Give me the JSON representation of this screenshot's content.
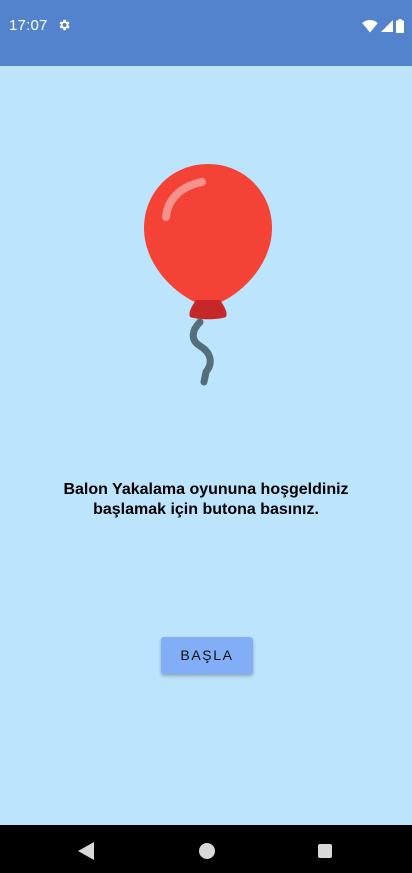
{
  "status_bar": {
    "time": "17:07",
    "icons": [
      "gear-icon",
      "wifi-icon",
      "signal-icon",
      "battery-icon"
    ]
  },
  "main": {
    "balloon_icon": "balloon-icon",
    "welcome_text": "Balon Yakalama oyununa hoşgeldiniz başlamak için butona basınız.",
    "start_button_label": "BAŞLA"
  },
  "nav_bar": {
    "icons": [
      "back-icon",
      "home-icon",
      "recents-icon"
    ]
  },
  "colors": {
    "app_bar": "#5383cc",
    "background": "#bde4fd",
    "button": "#82aef8",
    "balloon": "#f44336",
    "balloon_knot": "#c62828",
    "string": "#546e7a"
  }
}
